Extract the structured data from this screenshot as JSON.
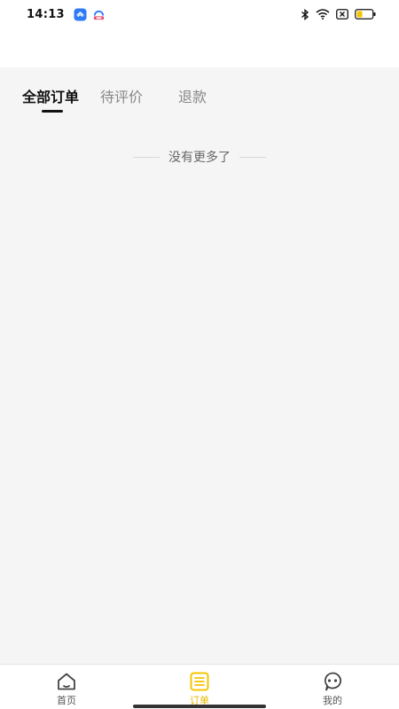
{
  "status_bar": {
    "time": "14:13",
    "battery_color": "#f5c400"
  },
  "tabs": [
    {
      "label": "全部订单",
      "active": true
    },
    {
      "label": "待评价",
      "active": false
    },
    {
      "label": "退款",
      "active": false
    }
  ],
  "list_footer": {
    "text": "没有更多了"
  },
  "bottom_nav": [
    {
      "label": "首页",
      "icon": "home-icon",
      "active": false
    },
    {
      "label": "订单",
      "icon": "orders-icon",
      "active": true
    },
    {
      "label": "我的",
      "icon": "profile-icon",
      "active": false
    }
  ],
  "colors": {
    "accent": "#f5c400",
    "background": "#f5f5f5"
  }
}
